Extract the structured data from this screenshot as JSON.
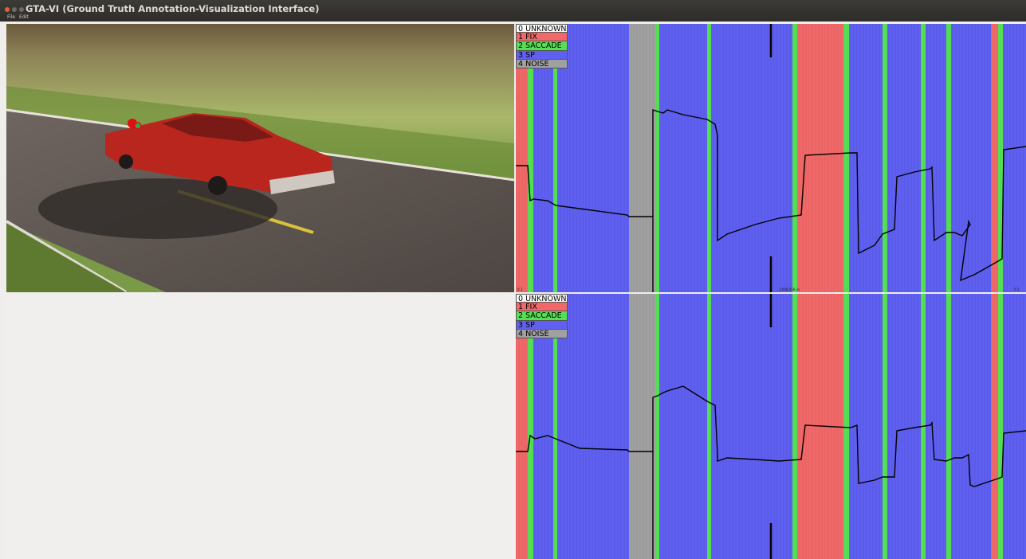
{
  "window": {
    "title": "GTA-VI (Ground Truth Annotation-Visualization Interface)"
  },
  "menu": {
    "file": "File",
    "edit": "Edit"
  },
  "legend": [
    {
      "label": "0 UNKNOWN",
      "color": "#ffffff"
    },
    {
      "label": "1 FIX",
      "color": "#f06868"
    },
    {
      "label": "2 SACCADE",
      "color": "#55e055"
    },
    {
      "label": "3 SP",
      "color": "#5f5ff0"
    },
    {
      "label": "4 NOISE",
      "color": "#a0a0a0"
    }
  ],
  "timeline": {
    "start_label": "0.1",
    "center_label": "2,648,058 us",
    "end_label": "0.1",
    "segment_sequence": [
      "FIX",
      "SACCADE",
      "SP",
      "SACCADE",
      "SP",
      "NOISE",
      "SACCADE",
      "SP",
      "SACCADE",
      "SP",
      "SACCADE",
      "FIX",
      "SACCADE",
      "SP",
      "SACCADE",
      "SP",
      "SACCADE",
      "SP",
      "SACCADE",
      "SP",
      "FIX",
      "SACCADE",
      "SP"
    ]
  },
  "colors": {
    "fix": "#f06868",
    "saccade": "#55e055",
    "sp": "#5f5ff0",
    "noise": "#a0a0a0",
    "unknown": "#ffffff",
    "gaze_marker": "#e01010",
    "gaze_marker_inner": "#2ea84a"
  }
}
